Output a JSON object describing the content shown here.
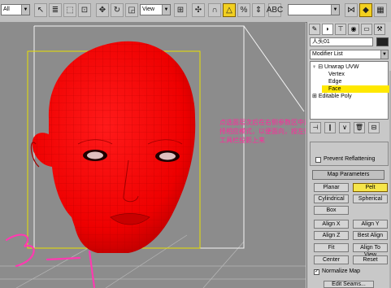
{
  "toolbar": {
    "selection_filter": "All",
    "reference_coord": "View",
    "named_selection": ""
  },
  "viewport": {
    "annotation": "点选面层次后在右侧参数区中选择相应模式，以便面向，按左侧工具栏投影上来",
    "handwritten": "3-1",
    "accent": "#ff0000",
    "annotation_color": "#ff2a9c"
  },
  "cmdpanel": {
    "object_name": "人头01",
    "modifier_list": "Modifier List",
    "stack": {
      "unwrap": "Unwrap UVW",
      "vertex": "Vertex",
      "edge": "Edge",
      "face": "Face",
      "poly": "Editable Poly"
    },
    "prevent_reflattening": "Prevent Reflattening",
    "map_parameters": "Map Parameters",
    "buttons": {
      "planar": "Planar",
      "pelt": "Pelt",
      "cylindrical": "Cylindrical",
      "spherical": "Spherical",
      "box": "Box",
      "align_x": "Align X",
      "align_y": "Align Y",
      "align_z": "Align Z",
      "best_align": "Best Align",
      "fit": "Fit",
      "align_to_view": "Align To View",
      "center": "Center",
      "reset": "Reset"
    },
    "normalize_map": "Normalize Map",
    "edit_seams": "Edit Seams..."
  }
}
